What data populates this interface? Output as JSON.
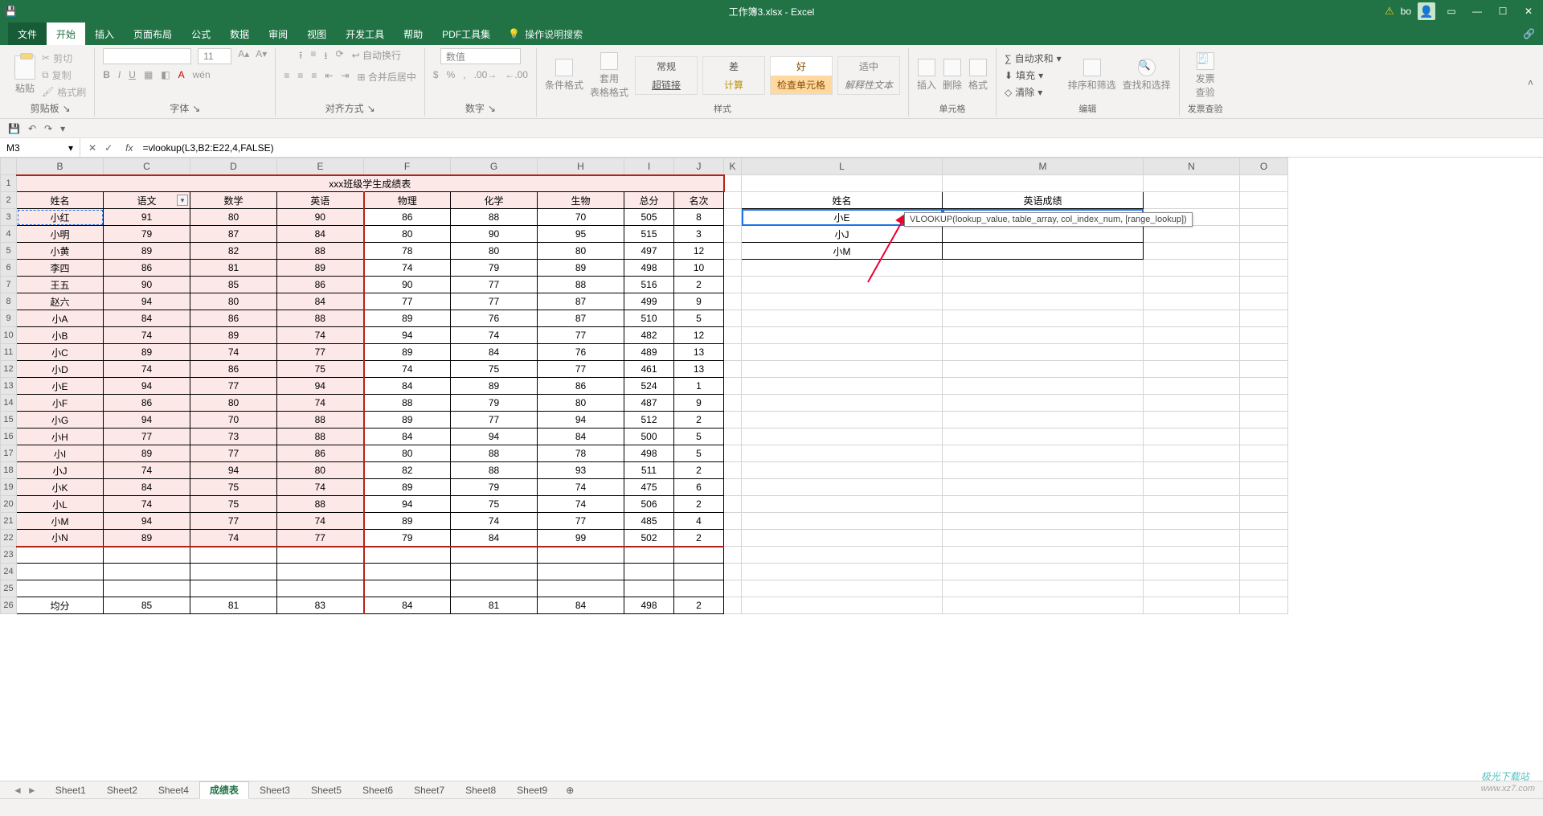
{
  "titlebar": {
    "title": "工作簿3.xlsx - Excel",
    "user": "bo",
    "warn": "⚠"
  },
  "menutabs": [
    "文件",
    "开始",
    "插入",
    "页面布局",
    "公式",
    "数据",
    "审阅",
    "视图",
    "开发工具",
    "帮助",
    "PDF工具集"
  ],
  "active_menu": "开始",
  "tell_me": "操作说明搜索",
  "share": "🔗",
  "ribbon": {
    "clipboard": {
      "paste": "粘贴",
      "cut": "剪切",
      "copy": "复制",
      "painter": "格式刷",
      "label": "剪贴板"
    },
    "font": {
      "font": "",
      "size": "11",
      "label": "字体"
    },
    "align": {
      "wrap": "自动换行",
      "merge": "合并后居中",
      "label": "对齐方式"
    },
    "number": {
      "type": "数值",
      "label": "数字"
    },
    "styles": {
      "cf": "条件格式",
      "tbl": "套用\n表格格式",
      "normal": "常规",
      "bad": "差",
      "good": "好",
      "neutral": "适中",
      "hyper": "超链接",
      "calc": "计算",
      "check": "检查单元格",
      "expl": "解释性文本",
      "label": "样式"
    },
    "cells": {
      "ins": "插入",
      "del": "删除",
      "fmt": "格式",
      "label": "单元格"
    },
    "editing": {
      "sum": "自动求和",
      "fill": "填充",
      "clear": "清除",
      "sort": "排序和筛选",
      "find": "查找和选择",
      "label": "编辑"
    },
    "invoice": {
      "btn": "发票\n查验",
      "label": "发票查验"
    }
  },
  "namebox": "M3",
  "formula": "=vlookup(L3,B2:E22,4,FALSE)",
  "formula_parts": {
    "pre": "=vlookup(",
    "a1": "L3",
    "c1": ",",
    "a2": "B2:E22",
    "post": ",4,FALSE)"
  },
  "tooltip": "VLOOKUP(lookup_value, table_array, col_index_num, [range_lookup])",
  "cols": [
    "B",
    "C",
    "D",
    "E",
    "F",
    "G",
    "H",
    "I",
    "J",
    "K",
    "L",
    "M",
    "N",
    "O"
  ],
  "title_row": "xxx班级学生成绩表",
  "headers": [
    "姓名",
    "语文",
    "数学",
    "英语",
    "物理",
    "化学",
    "生物",
    "总分",
    "名次"
  ],
  "headers2": {
    "name": "姓名",
    "eng": "英语成绩"
  },
  "lookup_names": [
    "小E",
    "小J",
    "小M"
  ],
  "rows": [
    [
      "小红",
      "91",
      "80",
      "90",
      "86",
      "88",
      "70",
      "505",
      "8"
    ],
    [
      "小明",
      "79",
      "87",
      "84",
      "80",
      "90",
      "95",
      "515",
      "3"
    ],
    [
      "小黄",
      "89",
      "82",
      "88",
      "78",
      "80",
      "80",
      "497",
      "12"
    ],
    [
      "李四",
      "86",
      "81",
      "89",
      "74",
      "79",
      "89",
      "498",
      "10"
    ],
    [
      "王五",
      "90",
      "85",
      "86",
      "90",
      "77",
      "88",
      "516",
      "2"
    ],
    [
      "赵六",
      "94",
      "80",
      "84",
      "77",
      "77",
      "87",
      "499",
      "9"
    ],
    [
      "小A",
      "84",
      "86",
      "88",
      "89",
      "76",
      "87",
      "510",
      "5"
    ],
    [
      "小B",
      "74",
      "89",
      "74",
      "94",
      "74",
      "77",
      "482",
      "12"
    ],
    [
      "小C",
      "89",
      "74",
      "77",
      "89",
      "84",
      "76",
      "489",
      "13"
    ],
    [
      "小D",
      "74",
      "86",
      "75",
      "74",
      "75",
      "77",
      "461",
      "13"
    ],
    [
      "小E",
      "94",
      "77",
      "94",
      "84",
      "89",
      "86",
      "524",
      "1"
    ],
    [
      "小F",
      "86",
      "80",
      "74",
      "88",
      "79",
      "80",
      "487",
      "9"
    ],
    [
      "小G",
      "94",
      "70",
      "88",
      "89",
      "77",
      "94",
      "512",
      "2"
    ],
    [
      "小H",
      "77",
      "73",
      "88",
      "84",
      "94",
      "84",
      "500",
      "5"
    ],
    [
      "小I",
      "89",
      "77",
      "86",
      "80",
      "88",
      "78",
      "498",
      "5"
    ],
    [
      "小J",
      "74",
      "94",
      "80",
      "82",
      "88",
      "93",
      "511",
      "2"
    ],
    [
      "小K",
      "84",
      "75",
      "74",
      "89",
      "79",
      "74",
      "475",
      "6"
    ],
    [
      "小L",
      "74",
      "75",
      "88",
      "94",
      "75",
      "74",
      "506",
      "2"
    ],
    [
      "小M",
      "94",
      "77",
      "74",
      "89",
      "74",
      "77",
      "485",
      "4"
    ],
    [
      "小N",
      "89",
      "74",
      "77",
      "79",
      "84",
      "99",
      "502",
      "2"
    ]
  ],
  "avg_label": "均分",
  "avg": [
    "85",
    "81",
    "83",
    "84",
    "81",
    "84",
    "498",
    "2"
  ],
  "sheets": [
    "Sheet1",
    "Sheet2",
    "Sheet4",
    "成绩表",
    "Sheet3",
    "Sheet5",
    "Sheet6",
    "Sheet7",
    "Sheet8",
    "Sheet9"
  ],
  "active_sheet": "成绩表",
  "watermark": {
    "brand": "极光下载站",
    "url": "www.xz7.com"
  }
}
